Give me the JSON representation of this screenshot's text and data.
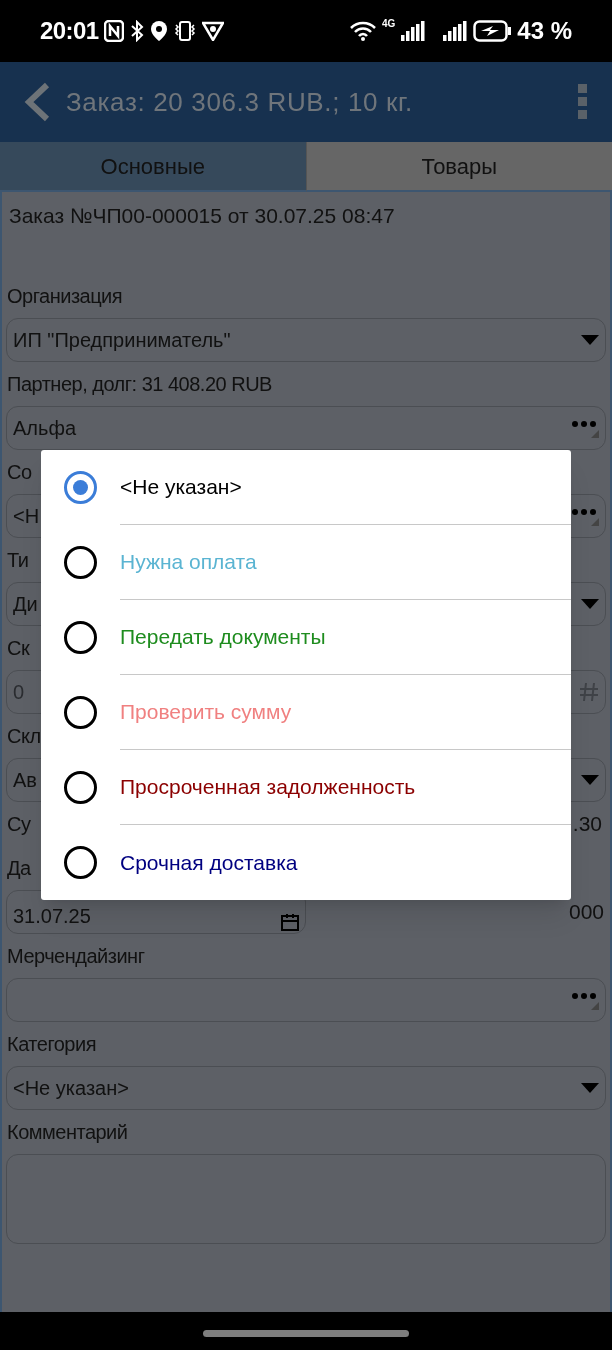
{
  "status_bar": {
    "time": "20:01",
    "network": "4G",
    "battery": "43 %"
  },
  "header": {
    "title": "Заказ: 20 306.3 RUB.; 10 кг."
  },
  "tabs": [
    {
      "label": "Основные",
      "selected": true
    },
    {
      "label": "Товары",
      "selected": false
    }
  ],
  "order_line": "Заказ №ЧП00-000015 от 30.07.25 08:47",
  "form": [
    {
      "label": "Организация",
      "kind": "dropdown",
      "value": "ИП \"Предприниматель\""
    },
    {
      "label": "Партнер, долг: 31 408.20 RUB",
      "kind": "picker",
      "value": "Альфа"
    },
    {
      "label": "Со",
      "kind": "picker",
      "value": "<Н"
    },
    {
      "label": "Ти",
      "kind": "dropdown",
      "value": "Ди"
    },
    {
      "label": "Ск",
      "kind": "number",
      "placeholder": "0"
    },
    {
      "label": "Скл",
      "kind": "dropdown",
      "value": "Ав"
    },
    {
      "label": "Су",
      "kind": "none",
      "aside": ".30"
    },
    {
      "label": "Да",
      "kind": "date",
      "value": "31.07.25",
      "aside": "000"
    },
    {
      "label": "Мерчендайзинг",
      "kind": "picker"
    },
    {
      "label": "Категория",
      "kind": "dropdown",
      "value": "<Не указан>"
    },
    {
      "label": "Комментарий",
      "kind": "textarea"
    }
  ],
  "dialog": {
    "options": [
      {
        "label": "<Не указан>",
        "color": "#000000",
        "selected": true
      },
      {
        "label": "Нужна оплата",
        "color": "#5ab4d2",
        "selected": false
      },
      {
        "label": "Передать документы",
        "color": "#1e8c1e",
        "selected": false
      },
      {
        "label": "Проверить сумму",
        "color": "#f08080",
        "selected": false
      },
      {
        "label": "Просроченная задолженность",
        "color": "#8b0000",
        "selected": false
      },
      {
        "label": "Срочная доставка",
        "color": "#000080",
        "selected": false
      }
    ]
  }
}
